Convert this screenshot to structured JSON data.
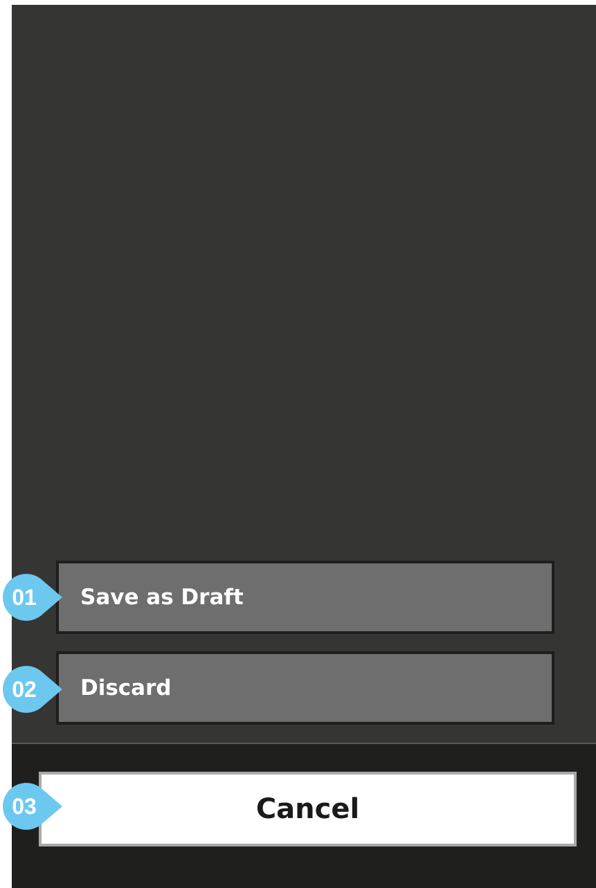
{
  "dialog": {
    "actions": [
      {
        "label": "Save as Draft",
        "marker": "01"
      },
      {
        "label": "Discard",
        "marker": "02"
      }
    ],
    "cancel": {
      "label": "Cancel",
      "marker": "03"
    }
  },
  "colors": {
    "overlay": "#353533",
    "footer": "#1f1f1d",
    "action_button": "#6e6e6e",
    "marker": "#6cc8ef"
  }
}
